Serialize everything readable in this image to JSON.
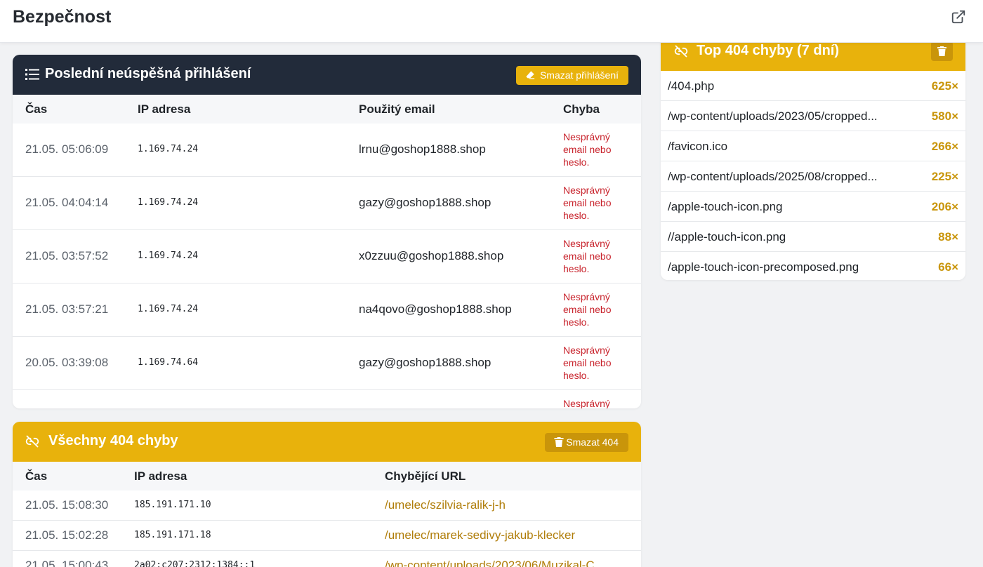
{
  "header": {
    "title": "Bezpečnost"
  },
  "failed_logins": {
    "title": "Poslední neúspěšná přihlášení",
    "clear_button": "Smazat přihlášení",
    "columns": [
      "Čas",
      "IP adresa",
      "Použitý email",
      "Chyba"
    ],
    "rows": [
      {
        "time": "21.05. 05:06:09",
        "ip": "1.169.74.24",
        "email": "lrnu@goshop1888.shop",
        "error": "Nesprávný email nebo heslo."
      },
      {
        "time": "21.05. 04:04:14",
        "ip": "1.169.74.24",
        "email": "gazy@goshop1888.shop",
        "error": "Nesprávný email nebo heslo."
      },
      {
        "time": "21.05. 03:57:52",
        "ip": "1.169.74.24",
        "email": "x0zzuu@goshop1888.shop",
        "error": "Nesprávný email nebo heslo."
      },
      {
        "time": "21.05. 03:57:21",
        "ip": "1.169.74.24",
        "email": "na4qovo@goshop1888.shop",
        "error": "Nesprávný email nebo heslo."
      },
      {
        "time": "20.05. 03:39:08",
        "ip": "1.169.74.64",
        "email": "gazy@goshop1888.shop",
        "error": "Nesprávný email nebo heslo."
      },
      {
        "time": "",
        "ip": "",
        "email": "",
        "error": "Nesprávný"
      }
    ]
  },
  "top404": {
    "title": "Top 404 chyby (7 dní)",
    "rows": [
      {
        "url": "/404.php",
        "count": "625×"
      },
      {
        "url": "/wp-content/uploads/2023/05/cropped...",
        "count": "580×"
      },
      {
        "url": "/favicon.ico",
        "count": "266×"
      },
      {
        "url": "/wp-content/uploads/2025/08/cropped...",
        "count": "225×"
      },
      {
        "url": "/apple-touch-icon.png",
        "count": "206×"
      },
      {
        "url": "//apple-touch-icon.png",
        "count": "88×"
      },
      {
        "url": "/apple-touch-icon-precomposed.png",
        "count": "66×"
      }
    ]
  },
  "all404": {
    "title": "Všechny 404 chyby",
    "clear_button": "Smazat 404",
    "columns": [
      "Čas",
      "IP adresa",
      "Chybějící URL"
    ],
    "rows": [
      {
        "time": "21.05. 15:08:30",
        "ip": "185.191.171.10",
        "url": "/umelec/szilvia-ralik-j-h"
      },
      {
        "time": "21.05. 15:02:28",
        "ip": "185.191.171.18",
        "url": "/umelec/marek-sedivy-jakub-klecker"
      },
      {
        "time": "21.05. 15:00:43",
        "ip": "2a02:c207:2312:1384::1",
        "url": "/wp-content/uploads/2023/06/Muzikal-C"
      }
    ]
  },
  "colors": {
    "accent": "#e8b20c",
    "accent_dark": "#c9950a",
    "header_dark": "#222b3a",
    "error": "#c8232c"
  },
  "icons": [
    "external-link-icon",
    "list-icon",
    "eraser-icon",
    "unlink-icon",
    "trash-icon"
  ]
}
